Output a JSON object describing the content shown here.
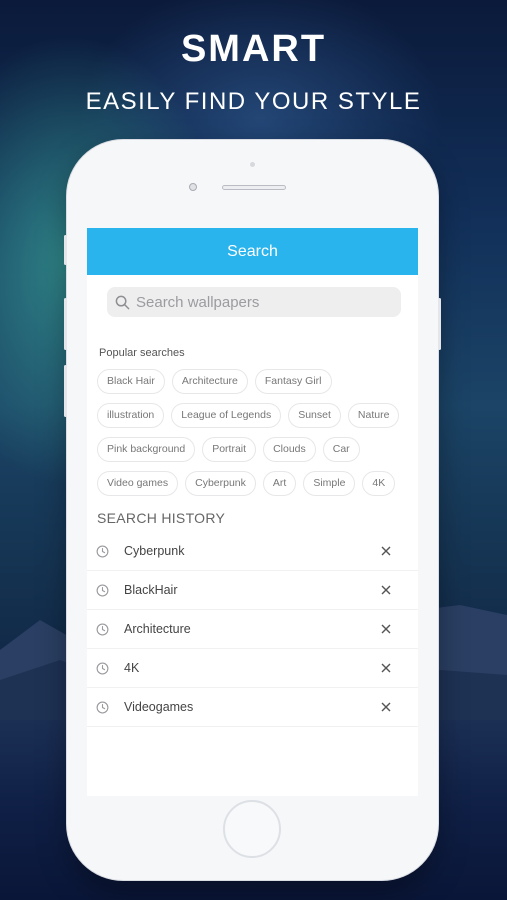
{
  "promo": {
    "headline": "SMART",
    "subline": "EASILY FIND YOUR STYLE"
  },
  "app": {
    "title": "Search",
    "accent": "#2ab4ee",
    "search": {
      "placeholder": "Search wallpapers",
      "icon": "search-icon"
    },
    "popular": {
      "label": "Popular searches",
      "tags": [
        "Black Hair",
        "Architecture",
        "Fantasy Girl",
        "illustration",
        "League of Legends",
        "Sunset",
        "Nature",
        "Pink background",
        "Portrait",
        "Clouds",
        "Car",
        "Video games",
        "Cyberpunk",
        "Art",
        "Simple",
        "4K"
      ]
    },
    "history": {
      "title": "SEARCH HISTORY",
      "items": [
        "Cyberpunk",
        "BlackHair",
        "Architecture",
        "4K",
        "Videogames"
      ],
      "item_icon": "clock-icon",
      "remove_icon": "close-icon"
    }
  }
}
